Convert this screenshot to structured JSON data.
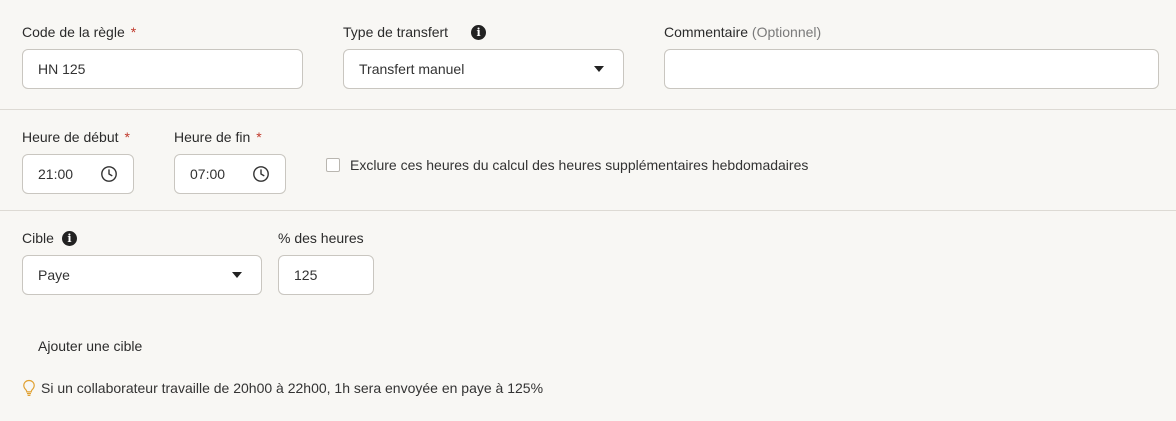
{
  "rule_code": {
    "label": "Code de la règle",
    "required_mark": "*",
    "value": "HN 125"
  },
  "transfer_type": {
    "label": "Type de transfert",
    "info_icon": "info-icon",
    "value": "Transfert manuel"
  },
  "comment": {
    "label": "Commentaire",
    "optional_text": "(Optionnel)",
    "value": ""
  },
  "start_time": {
    "label": "Heure de début",
    "required_mark": "*",
    "value": "21:00",
    "icon": "clock-icon"
  },
  "end_time": {
    "label": "Heure de fin",
    "required_mark": "*",
    "value": "07:00",
    "icon": "clock-icon"
  },
  "exclude_checkbox": {
    "label": "Exclure ces heures du calcul des heures supplémentaires hebdomadaires",
    "checked": false
  },
  "target": {
    "label": "Cible",
    "info_icon": "info-icon",
    "value": "Paye"
  },
  "percent_hours": {
    "label": "% des heures",
    "value": "125"
  },
  "add_target": {
    "label": "Ajouter une cible"
  },
  "hint": {
    "icon": "lightbulb-icon",
    "text": "Si un collaborateur travaille de 20h00 à 22h00, 1h sera envoyée en paye à 125%"
  }
}
